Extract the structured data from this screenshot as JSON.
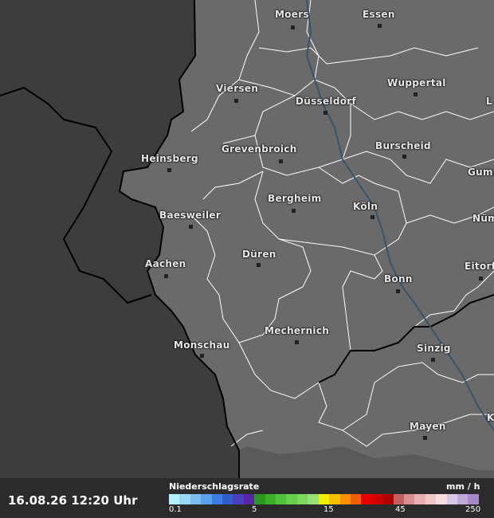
{
  "timestamp": "16.08.26 12:20 Uhr",
  "legend": {
    "title": "Niederschlagsrate",
    "unit": "mm / h",
    "ticks": [
      "0.1",
      "5",
      "15",
      "45",
      "250"
    ],
    "colors": [
      "#b2f0ff",
      "#9ad8f8",
      "#7cbcf0",
      "#5aa0ea",
      "#3a7ee2",
      "#2f5fcf",
      "#4a3fbf",
      "#5a24a8",
      "#2a9a1e",
      "#3cb02a",
      "#52c23a",
      "#66d04c",
      "#7ad85e",
      "#98e07a",
      "#f0f000",
      "#f8c000",
      "#f89000",
      "#f06000",
      "#e80000",
      "#d00000",
      "#b00000",
      "#c06060",
      "#d89090",
      "#e8b0b0",
      "#f0c8c8",
      "#f8dede",
      "#d8c8e8",
      "#c0a8d8",
      "#a888c8"
    ]
  },
  "cities": [
    {
      "name": "Moers"
    },
    {
      "name": "Essen"
    },
    {
      "name": "Viersen"
    },
    {
      "name": "Düsseldorf"
    },
    {
      "name": "Wuppertal"
    },
    {
      "name": "L"
    },
    {
      "name": "Heinsberg"
    },
    {
      "name": "Grevenbroich"
    },
    {
      "name": "Burscheid"
    },
    {
      "name": "Gumm"
    },
    {
      "name": "Bergheim"
    },
    {
      "name": "Köln"
    },
    {
      "name": "Baesweiler"
    },
    {
      "name": "Nüm"
    },
    {
      "name": "Aachen"
    },
    {
      "name": "Düren"
    },
    {
      "name": "Eitorf"
    },
    {
      "name": "Bonn"
    },
    {
      "name": "Mechernich"
    },
    {
      "name": "Monschau"
    },
    {
      "name": "Sinzig"
    },
    {
      "name": "Mayen"
    },
    {
      "name": "K"
    }
  ]
}
